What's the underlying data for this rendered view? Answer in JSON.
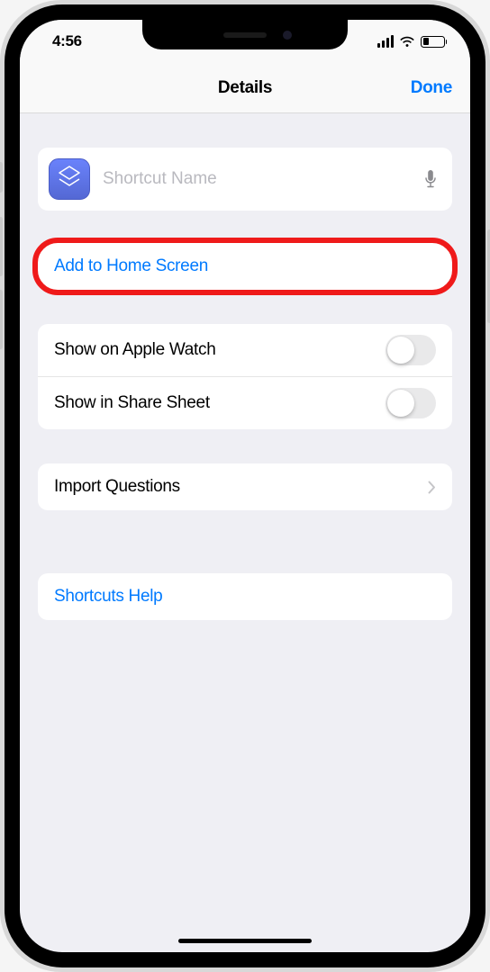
{
  "status": {
    "time": "4:56"
  },
  "nav": {
    "title": "Details",
    "done": "Done"
  },
  "name_field": {
    "placeholder": "Shortcut Name",
    "value": ""
  },
  "actions": {
    "add_home": "Add to Home Screen"
  },
  "toggles": {
    "apple_watch": "Show on Apple Watch",
    "share_sheet": "Show in Share Sheet"
  },
  "import": {
    "label": "Import Questions"
  },
  "help": {
    "label": "Shortcuts Help"
  }
}
